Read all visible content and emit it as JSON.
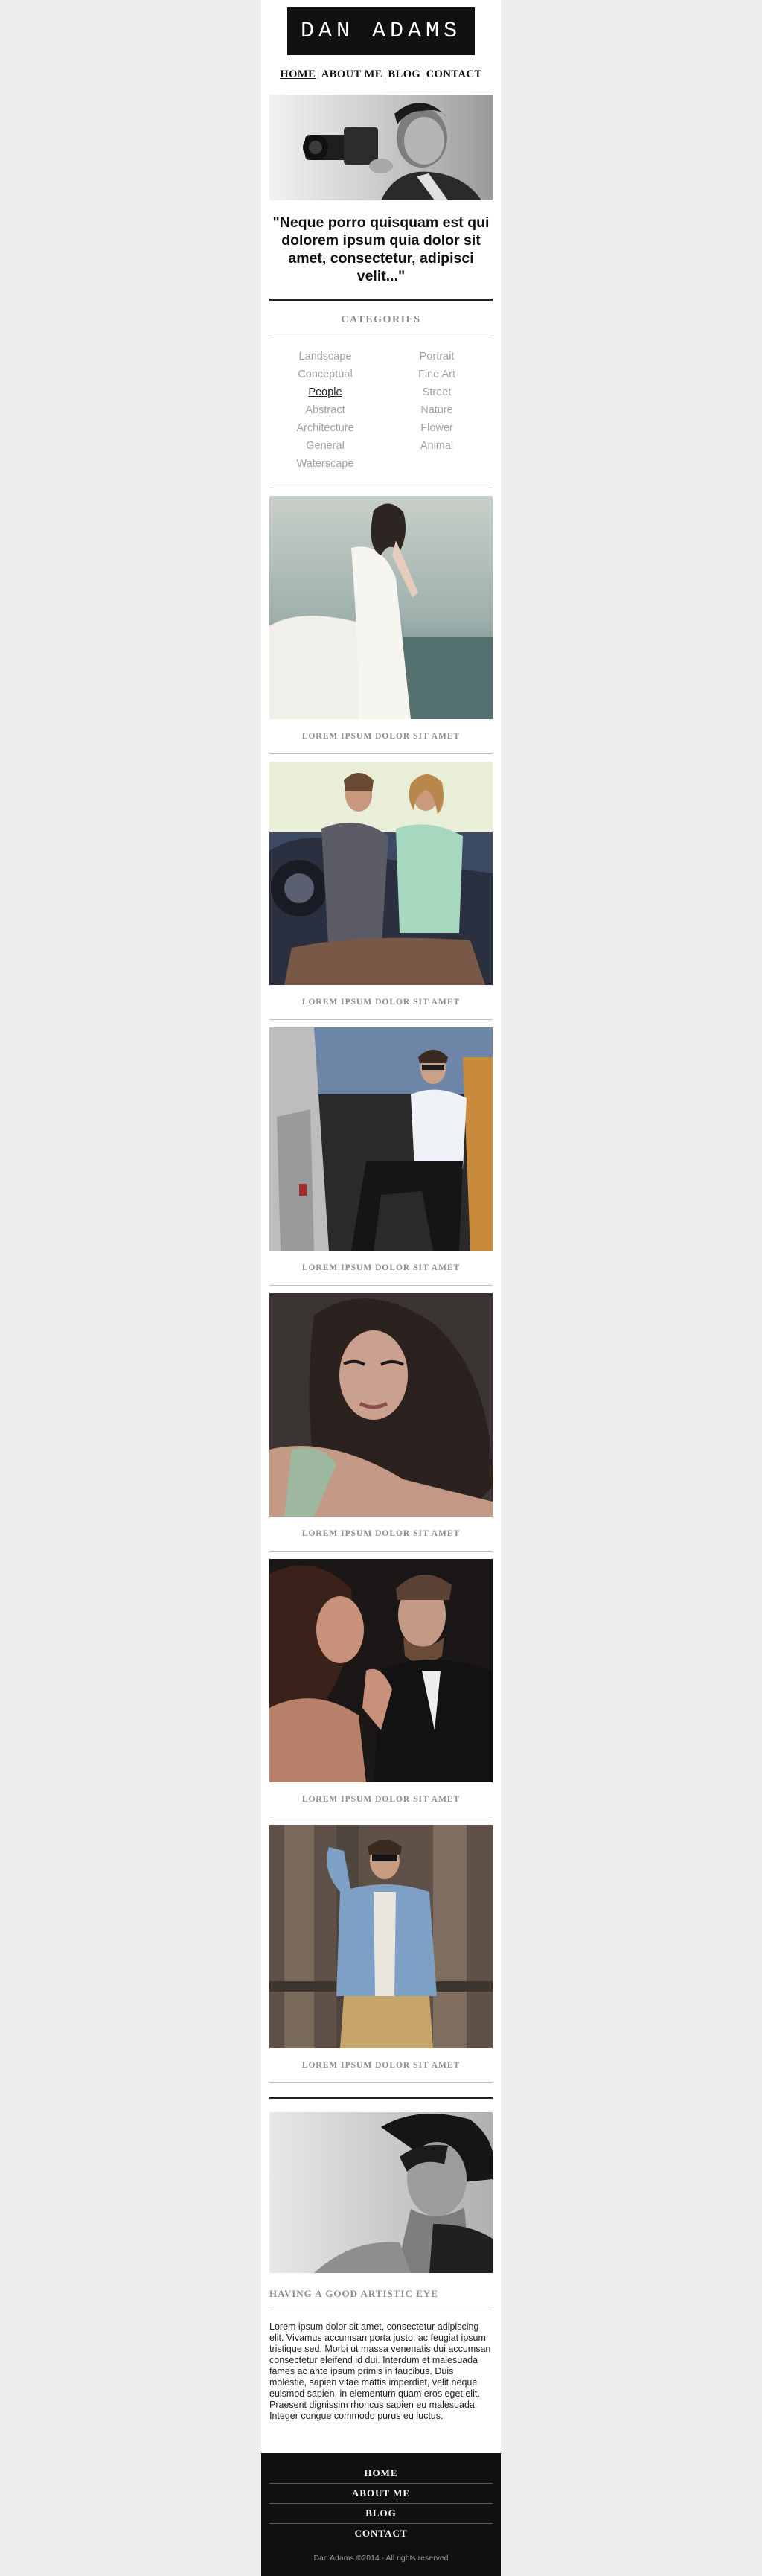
{
  "header": {
    "logo_text": "DAN  ADAMS",
    "nav": [
      "HOME",
      "ABOUT ME",
      "BLOG",
      "CONTACT"
    ],
    "nav_active": "HOME"
  },
  "quote": "\"Neque porro quisquam est qui dolorem ipsum quia dolor sit amet, consectetur, adipisci velit...\"",
  "categories": {
    "title": "CATEGORIES",
    "left": [
      "Landscape",
      "Conceptual",
      "People",
      "Abstract",
      "Architecture",
      "General",
      "Waterscape"
    ],
    "right": [
      "Portrait",
      "Fine Art",
      "Street",
      "Nature",
      "Flower",
      "Animal"
    ],
    "active": "People"
  },
  "gallery": [
    {
      "caption": "LOREM IPSUM DOLOR SIT AMET",
      "image": "woman-white-dress-by-sea"
    },
    {
      "caption": "LOREM IPSUM DOLOR SIT AMET",
      "image": "couple-on-car"
    },
    {
      "caption": "LOREM IPSUM DOLOR SIT AMET",
      "image": "man-in-car-door"
    },
    {
      "caption": "LOREM IPSUM DOLOR SIT AMET",
      "image": "woman-portrait"
    },
    {
      "caption": "LOREM IPSUM DOLOR SIT AMET",
      "image": "couple-embrace"
    },
    {
      "caption": "LOREM IPSUM DOLOR SIT AMET",
      "image": "man-denim-jacket"
    }
  ],
  "feature": {
    "title": "HAVING A GOOD ARTISTIC EYE",
    "text": "Lorem ipsum dolor sit amet, consectetur adipiscing elit. Vivamus accumsan porta justo, ac feugiat ipsum tristique sed. Morbi ut massa venenatis dui accumsan consectetur eleifend id dui. Interdum et malesuada fames ac ante ipsum primis in faucibus. Duis molestie, sapien vitae mattis imperdiet, velit neque euismod sapien, in elementum quam eros eget elit. Praesent dignissim rhoncus sapien eu malesuada. Integer congue commodo purus eu luctus."
  },
  "footer": {
    "links": [
      "HOME",
      "ABOUT ME",
      "BLOG",
      "CONTACT"
    ],
    "copyright": "Dan Adams ©2014 - All rights reserved"
  }
}
